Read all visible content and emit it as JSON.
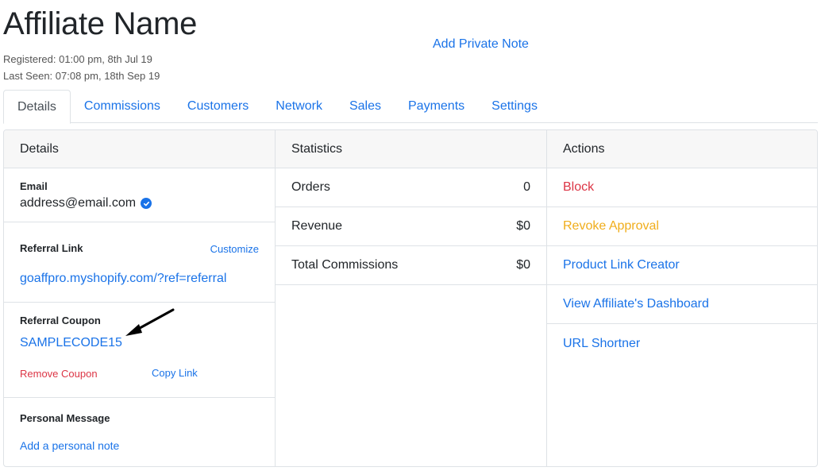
{
  "header": {
    "title": "Affiliate Name",
    "registered": "Registered: 01:00 pm, 8th Jul 19",
    "last_seen": "Last Seen: 07:08 pm, 18th Sep 19",
    "private_note_link": "Add Private Note"
  },
  "tabs": [
    {
      "label": "Details",
      "active": true
    },
    {
      "label": "Commissions"
    },
    {
      "label": "Customers"
    },
    {
      "label": "Network"
    },
    {
      "label": "Sales"
    },
    {
      "label": "Payments"
    },
    {
      "label": "Settings"
    }
  ],
  "details": {
    "heading": "Details",
    "email_label": "Email",
    "email_value": "address@email.com",
    "verified_icon": "check-circle-icon",
    "referral_link_label": "Referral Link",
    "customize_label": "Customize",
    "referral_url": "goaffpro.myshopify.com/?ref=referral",
    "coupon_label": "Referral Coupon",
    "coupon_code": "SAMPLECODE15",
    "remove_coupon": "Remove Coupon",
    "copy_link": "Copy Link",
    "personal_message_label": "Personal Message",
    "add_personal_note": "Add a personal note"
  },
  "statistics": {
    "heading": "Statistics",
    "rows": [
      {
        "label": "Orders",
        "value": "0"
      },
      {
        "label": "Revenue",
        "value": "$0"
      },
      {
        "label": "Total Commissions",
        "value": "$0"
      }
    ]
  },
  "actions": {
    "heading": "Actions",
    "items": [
      {
        "label": "Block",
        "color": "#dc3545"
      },
      {
        "label": "Revoke Approval",
        "color": "#f0ad1b"
      },
      {
        "label": "Product Link Creator",
        "color": "#1a73e8"
      },
      {
        "label": "View Affiliate's Dashboard",
        "color": "#1a73e8"
      },
      {
        "label": "URL Shortner",
        "color": "#1a73e8"
      }
    ]
  },
  "colors": {
    "link": "#1a73e8",
    "danger": "#dc3545",
    "warning": "#f0ad1b",
    "border": "#dee2e6",
    "header_bg": "#f7f7f7"
  }
}
